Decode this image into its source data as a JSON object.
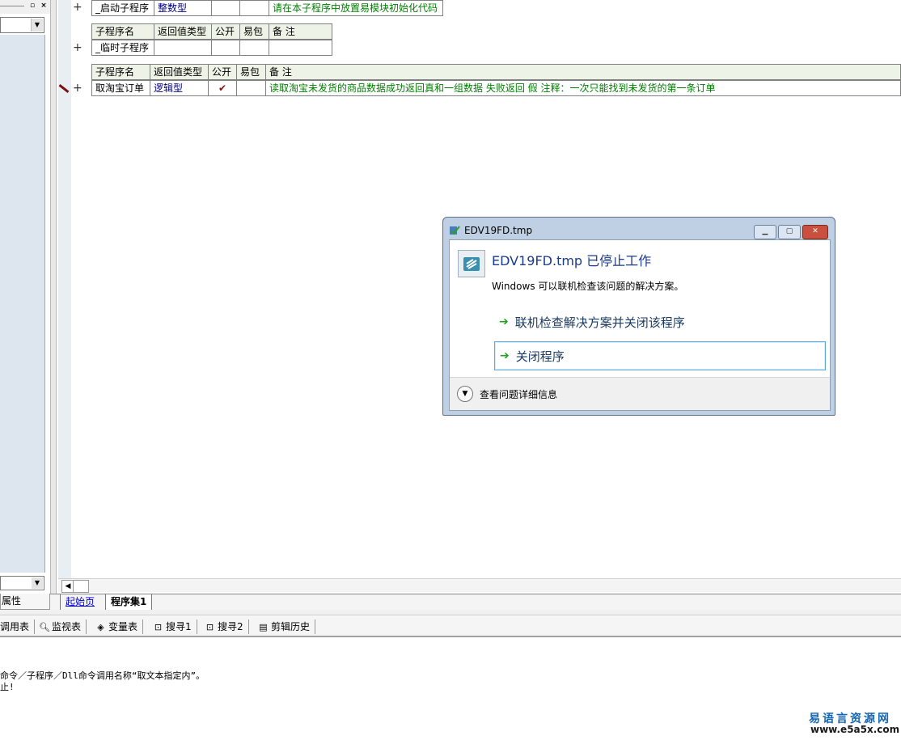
{
  "left_panel": {
    "tab_label": "属性"
  },
  "tables": [
    {
      "rows": [
        {
          "cells": [
            "_启动子程序",
            "整数型",
            "",
            "",
            "请在本子程序中放置易模块初始化代码"
          ]
        }
      ]
    },
    {
      "header": [
        "子程序名",
        "返回值类型",
        "公开",
        "易包",
        "备 注"
      ],
      "rows": [
        {
          "cells": [
            "_临时子程序",
            "",
            "",
            "",
            ""
          ]
        }
      ]
    },
    {
      "header": [
        "子程序名",
        "返回值类型",
        "公开",
        "易包",
        "备 注"
      ],
      "rows": [
        {
          "cells": [
            "取淘宝订单",
            "逻辑型",
            "✔",
            "",
            "读取淘宝未发货的商品数据成功返回真和一组数据   失败返回 假   注释：一次只能找到未发货的第一条订单"
          ]
        }
      ]
    }
  ],
  "tabs": {
    "home": "起始页",
    "program": "程序集1"
  },
  "toolbar": [
    "调用表",
    "监视表",
    "变量表",
    "搜寻1",
    "搜寻2",
    "剪辑历史"
  ],
  "output": {
    "line1": "命令／子程序／Dll命令调用名称“取文本指定内”。",
    "line2": "止!"
  },
  "dialog": {
    "title": "EDV19FD.tmp",
    "heading": "EDV19FD.tmp 已停止工作",
    "message": "Windows 可以联机检查该问题的解决方案。",
    "option1": "联机检查解决方案并关闭该程序",
    "option2": "关闭程序",
    "details": "查看问题详细信息"
  },
  "watermark": {
    "cn": "易语言资源网",
    "url": "www.e5a5x.com"
  }
}
